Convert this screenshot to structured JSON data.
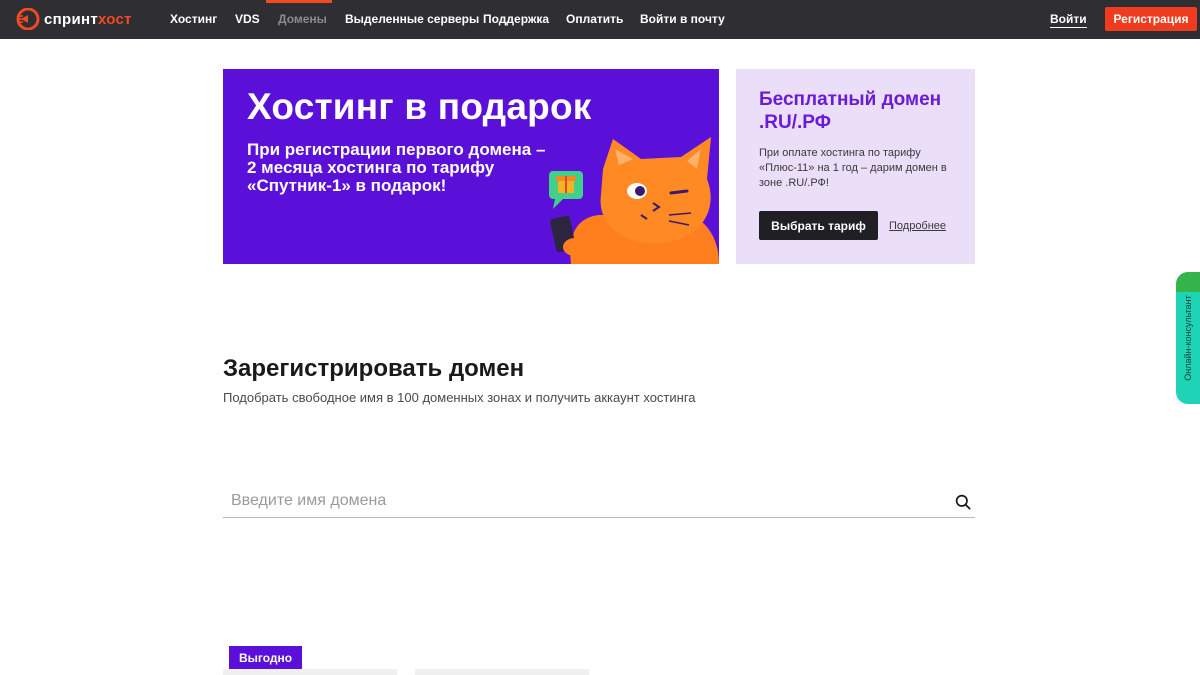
{
  "header": {
    "logo": {
      "part1": "спринт",
      "part2": "хост"
    },
    "nav": [
      {
        "label": "Хостинг",
        "active": false
      },
      {
        "label": "VDS",
        "active": false
      },
      {
        "label": "Домены",
        "active": true
      },
      {
        "label": "Выделенные серверы",
        "active": false
      },
      {
        "label": "Поддержка",
        "active": false
      },
      {
        "label": "Оплатить",
        "active": false
      },
      {
        "label": "Войти в почту",
        "active": false
      }
    ],
    "login": "Войти",
    "register": "Регистрация",
    "colors": {
      "bar": "#2e2e33",
      "accent": "#f03c1e"
    }
  },
  "promo": {
    "main": {
      "title": "Хостинг в подарок",
      "text": "При регистрации первого домена – 2 месяца хостинга по тарифу «Спутник-1» в подарок!",
      "color": "#5a10d8"
    },
    "side": {
      "title": "Бесплатный домен .RU/.РФ",
      "text": "При оплате хостинга по тарифу «Плюс-11» на 1 год – дарим домен в зоне .RU/.РФ!",
      "button": "Выбрать тариф",
      "link": "Подробнее",
      "color": "#ebdef8"
    }
  },
  "register_domain": {
    "title": "Зарегистрировать домен",
    "subtitle": "Подобрать свободное имя в 100 доменных зонах и получить аккаунт хостинга",
    "search": {
      "placeholder": "Введите имя домена",
      "value": "",
      "icon": "search-icon"
    }
  },
  "tariffs": {
    "badge": "Выгодно"
  },
  "consultant": {
    "label": "Онлайн-консультант"
  }
}
